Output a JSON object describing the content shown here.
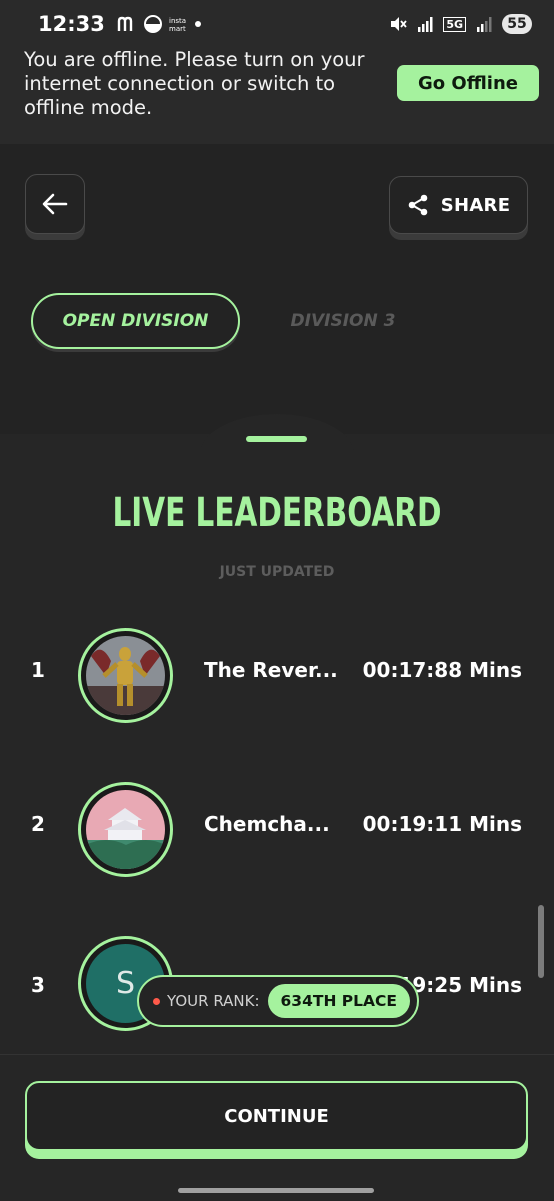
{
  "status_bar": {
    "time": "12:33",
    "network": "5G",
    "battery": "55"
  },
  "offline_banner": {
    "message": "You are offline. Please turn on your internet connection or switch to offline mode.",
    "button_label": "Go Offline"
  },
  "header": {
    "share_label": "SHARE"
  },
  "tabs": [
    {
      "label": "OPEN DIVISION",
      "active": true
    },
    {
      "label": "DIVISION 3",
      "active": false
    }
  ],
  "leaderboard": {
    "title": "LIVE LEADERBOARD",
    "subtitle": "JUST UPDATED",
    "entries": [
      {
        "rank": "1",
        "name": "The Rever...",
        "time": "00:17:88 Mins"
      },
      {
        "rank": "2",
        "name": "Chemcha...",
        "time": "00:19:11 Mins"
      },
      {
        "rank": "3",
        "name": "",
        "time": "19:25 Mins",
        "avatar_letter": "S"
      }
    ]
  },
  "your_rank": {
    "label": "YOUR RANK:",
    "value": "634TH PLACE"
  },
  "footer": {
    "continue_label": "CONTINUE"
  },
  "colors": {
    "accent": "#a5f29e",
    "background": "#262626"
  }
}
